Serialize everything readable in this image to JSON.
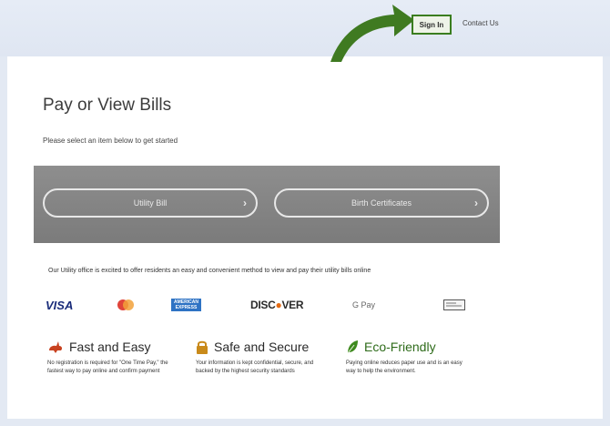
{
  "header": {
    "sign_in_label": "Sign In",
    "contact_label": "Contact Us"
  },
  "main": {
    "title": "Pay or View Bills",
    "subtitle": "Please select an item below to get started",
    "buttons": [
      {
        "label": "Utility Bill"
      },
      {
        "label": "Birth Certificates"
      }
    ],
    "intro": "Our Utility office is excited to offer residents an easy and convenient method to view and pay their utility bills online"
  },
  "payments": {
    "visa": "VISA",
    "amex_line1": "AMERICAN",
    "amex_line2": "EXPRESS",
    "discover_a": "DISC",
    "discover_o": "●",
    "discover_b": "VER",
    "gpay": "G Pay"
  },
  "features": [
    {
      "title": "Fast and Easy",
      "desc": "No registration is required for \"One Time Pay,\" the fastest way to pay online and confirm payment"
    },
    {
      "title": "Safe and Secure",
      "desc": "Your information is kept confidential, secure, and backed by the highest security standards"
    },
    {
      "title": "Eco-Friendly",
      "desc": "Paying online reduces paper use and is an easy way to help the environment."
    }
  ],
  "colors": {
    "accent_green": "#3a7d1f",
    "banner_gray": "#858585",
    "rabbit_red": "#c8411f",
    "lock_gold": "#c98a1a",
    "leaf_green": "#3e8a1e"
  },
  "icons": [
    "arrow-annotation-icon",
    "rabbit-icon",
    "lock-icon",
    "leaf-icon",
    "chevron-right-icon"
  ]
}
